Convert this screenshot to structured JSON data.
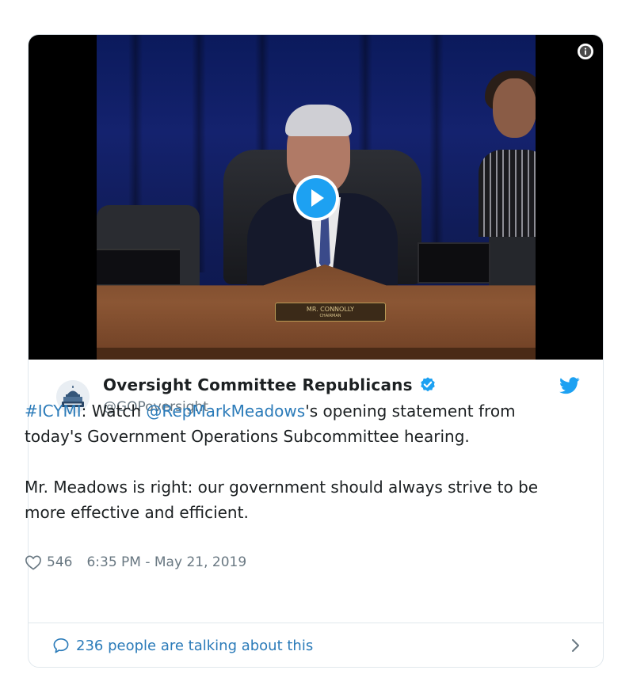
{
  "video": {
    "nameplate_name": "MR. CONNOLLY",
    "nameplate_title": "CHAIRMAN",
    "info_icon": "info-icon",
    "play_icon": "play-icon"
  },
  "author": {
    "display_name": "Oversight Committee Republicans",
    "handle": "@GOPoversight",
    "verified": true,
    "avatar_icon": "capitol-building-seal",
    "brand_icon": "twitter-bird-icon"
  },
  "tweet": {
    "hashtag": "#ICYMI",
    "part1": ": Watch ",
    "mention": "@RepMarkMeadows",
    "part2": "'s opening statement from today's Government Operations Subcommittee hearing.",
    "paragraph2": "Mr. Meadows is right: our government should always strive to be more effective and efficient."
  },
  "meta": {
    "likes": "546",
    "timestamp": "6:35 PM - May 21, 2019"
  },
  "footer": {
    "label": "236 people are talking about this"
  },
  "colors": {
    "link": "#2b7bb9",
    "muted": "#697882",
    "text": "#1c2022",
    "border": "#e1e8ed",
    "verified": "#1da1f2"
  }
}
